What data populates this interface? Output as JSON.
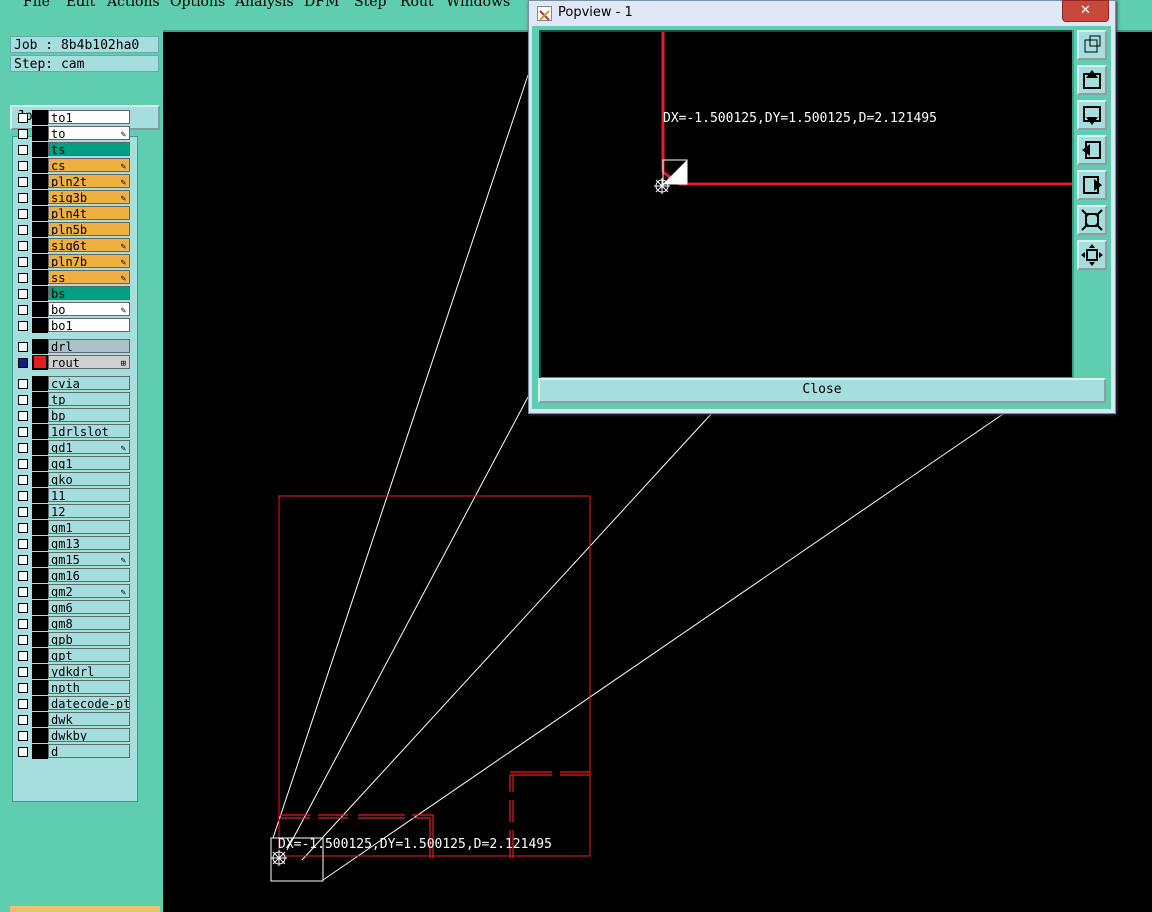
{
  "menu": {
    "items": [
      "File",
      "Edit",
      "Actions",
      "Options",
      "Analysis",
      "DFM",
      "Step",
      "Rout",
      "Windows"
    ]
  },
  "left_panel": {
    "job_label": "Job : 8b4b102ha0",
    "step_label": "Step: cam",
    "job_matrix_button": "Job Matrix ...",
    "board_layers": [
      {
        "name": "to1",
        "color": "#ffffff",
        "marked": false
      },
      {
        "name": "to",
        "color": "#ffffff",
        "marked": true
      },
      {
        "name": "ts",
        "color": "#00a080",
        "marked": false
      },
      {
        "name": "cs",
        "color": "#f0b040",
        "marked": true
      },
      {
        "name": "pln2t",
        "color": "#f0b040",
        "marked": true
      },
      {
        "name": "sig3b",
        "color": "#f0b040",
        "marked": true
      },
      {
        "name": "pln4t",
        "color": "#f0b040",
        "marked": false
      },
      {
        "name": "pln5b",
        "color": "#f0b040",
        "marked": false
      },
      {
        "name": "sig6t",
        "color": "#f0b040",
        "marked": true
      },
      {
        "name": "pln7b",
        "color": "#f0b040",
        "marked": true
      },
      {
        "name": "ss",
        "color": "#f0b040",
        "marked": true
      },
      {
        "name": "bs",
        "color": "#00a080",
        "marked": false
      },
      {
        "name": "bo",
        "color": "#ffffff",
        "marked": true
      },
      {
        "name": "bo1",
        "color": "#ffffff",
        "marked": false
      }
    ],
    "drill_layers": [
      {
        "name": "drl",
        "color": "#b0c0c8",
        "marked": false,
        "active": false
      },
      {
        "name": "rout",
        "color": "#d0d0d0",
        "marked": false,
        "active": true
      }
    ],
    "misc_layers": [
      {
        "name": "cvia",
        "marked": false
      },
      {
        "name": "tp",
        "marked": false
      },
      {
        "name": "bp",
        "marked": false
      },
      {
        "name": "1drlslot",
        "marked": false
      },
      {
        "name": "gd1",
        "marked": true
      },
      {
        "name": "gg1",
        "marked": false
      },
      {
        "name": "gko",
        "marked": false
      },
      {
        "name": "11",
        "marked": false
      },
      {
        "name": "12",
        "marked": false
      },
      {
        "name": "gm1",
        "marked": false
      },
      {
        "name": "gm13",
        "marked": false
      },
      {
        "name": "gm15",
        "marked": true
      },
      {
        "name": "gm16",
        "marked": false
      },
      {
        "name": "gm2",
        "marked": true
      },
      {
        "name": "gm6",
        "marked": false
      },
      {
        "name": "gm8",
        "marked": false
      },
      {
        "name": "gpb",
        "marked": false
      },
      {
        "name": "gpt",
        "marked": false
      },
      {
        "name": "ydkdrl",
        "marked": false
      },
      {
        "name": "npth",
        "marked": false
      },
      {
        "name": "datecode-pte",
        "marked": false
      },
      {
        "name": "dwk",
        "marked": false
      },
      {
        "name": "dwkby",
        "marked": false
      },
      {
        "name": "d",
        "marked": false
      }
    ]
  },
  "popview": {
    "title": "Popview - 1",
    "close_x": "✕",
    "measure_text": "DX=-1.500125,DY=1.500125,D=2.121495",
    "close_button": "Close",
    "tool_icons": [
      "zoom-window-icon",
      "pan-up-icon",
      "pan-down-icon",
      "pan-left-icon",
      "pan-right-icon",
      "zoom-in-icon",
      "zoom-out-icon"
    ]
  },
  "main_view": {
    "measure_text": "DX=-1.500125,DY=1.500125,D=2.121495"
  },
  "colors": {
    "panel_bg": "#5fcdb0",
    "layer_bg": "#a6dede",
    "outline_red": "#e02020"
  }
}
